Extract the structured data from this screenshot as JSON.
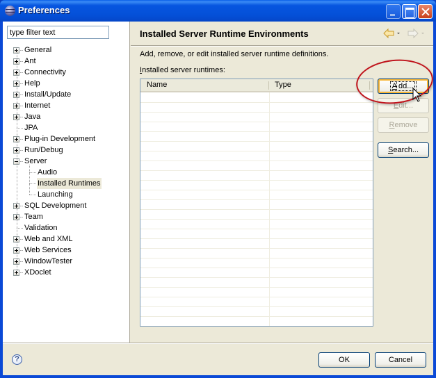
{
  "window": {
    "title": "Preferences"
  },
  "sidebar": {
    "filter_placeholder": "type filter text",
    "filter_value": "type filter text",
    "tree": [
      {
        "label": "General",
        "expandable": true,
        "expanded": false
      },
      {
        "label": "Ant",
        "expandable": true,
        "expanded": false
      },
      {
        "label": "Connectivity",
        "expandable": true,
        "expanded": false
      },
      {
        "label": "Help",
        "expandable": true,
        "expanded": false
      },
      {
        "label": "Install/Update",
        "expandable": true,
        "expanded": false
      },
      {
        "label": "Internet",
        "expandable": true,
        "expanded": false
      },
      {
        "label": "Java",
        "expandable": true,
        "expanded": false
      },
      {
        "label": "JPA",
        "expandable": false
      },
      {
        "label": "Plug-in Development",
        "expandable": true,
        "expanded": false
      },
      {
        "label": "Run/Debug",
        "expandable": true,
        "expanded": false
      },
      {
        "label": "Server",
        "expandable": true,
        "expanded": true,
        "children": [
          {
            "label": "Audio"
          },
          {
            "label": "Installed Runtimes",
            "selected": true
          },
          {
            "label": "Launching"
          }
        ]
      },
      {
        "label": "SQL Development",
        "expandable": true,
        "expanded": false
      },
      {
        "label": "Team",
        "expandable": true,
        "expanded": false
      },
      {
        "label": "Validation",
        "expandable": false
      },
      {
        "label": "Web and XML",
        "expandable": true,
        "expanded": false
      },
      {
        "label": "Web Services",
        "expandable": true,
        "expanded": false
      },
      {
        "label": "WindowTester",
        "expandable": true,
        "expanded": false
      },
      {
        "label": "XDoclet",
        "expandable": true,
        "expanded": false
      }
    ]
  },
  "page": {
    "title": "Installed Server Runtime Environments",
    "description": "Add, remove, or edit installed server runtime definitions.",
    "table_label_mnemonic": "I",
    "table_label_rest": "nstalled server runtimes:",
    "table": {
      "columns": [
        "Name",
        "Type"
      ],
      "rows": []
    },
    "buttons": {
      "add": {
        "mnemonic": "A",
        "rest": "dd...",
        "enabled": true,
        "focused": true
      },
      "edit": {
        "mnemonic": "E",
        "rest": "dit...",
        "enabled": false
      },
      "remove": {
        "mnemonic": "R",
        "rest": "emove",
        "enabled": false
      },
      "search": {
        "mnemonic": "S",
        "rest": "earch...",
        "enabled": true
      }
    },
    "nav": {
      "back_icon": "back-arrow-icon",
      "forward_icon": "forward-arrow-icon"
    }
  },
  "footer": {
    "help_icon": "?",
    "ok_label": "OK",
    "cancel_label": "Cancel"
  },
  "annotation": {
    "highlight_color": "#c0141c",
    "target": "Add..."
  }
}
